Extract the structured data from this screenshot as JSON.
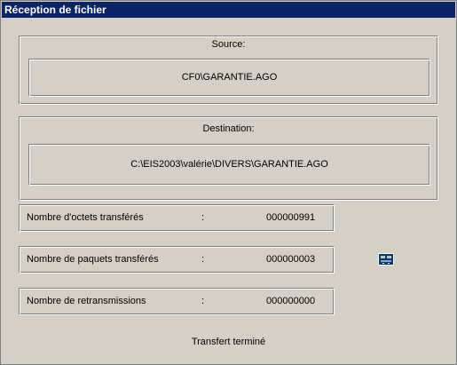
{
  "window": {
    "title": "Réception de fichier"
  },
  "source": {
    "label": "Source:",
    "value": "CF0\\GARANTIE.AGO"
  },
  "destination": {
    "label": "Destination:",
    "value": "C:\\EIS2003\\valérie\\DIVERS\\GARANTIE.AGO"
  },
  "stats": [
    {
      "label": "Nombre d'octets transférés",
      "sep": ":",
      "value": "000000991"
    },
    {
      "label": "Nombre de paquets transférés",
      "sep": ":",
      "value": "000000003"
    },
    {
      "label": "Nombre de retransmissions",
      "sep": ":",
      "value": "000000000"
    }
  ],
  "status": "Transfert terminé",
  "icons": {
    "transfer": "network-transfer-icon"
  }
}
